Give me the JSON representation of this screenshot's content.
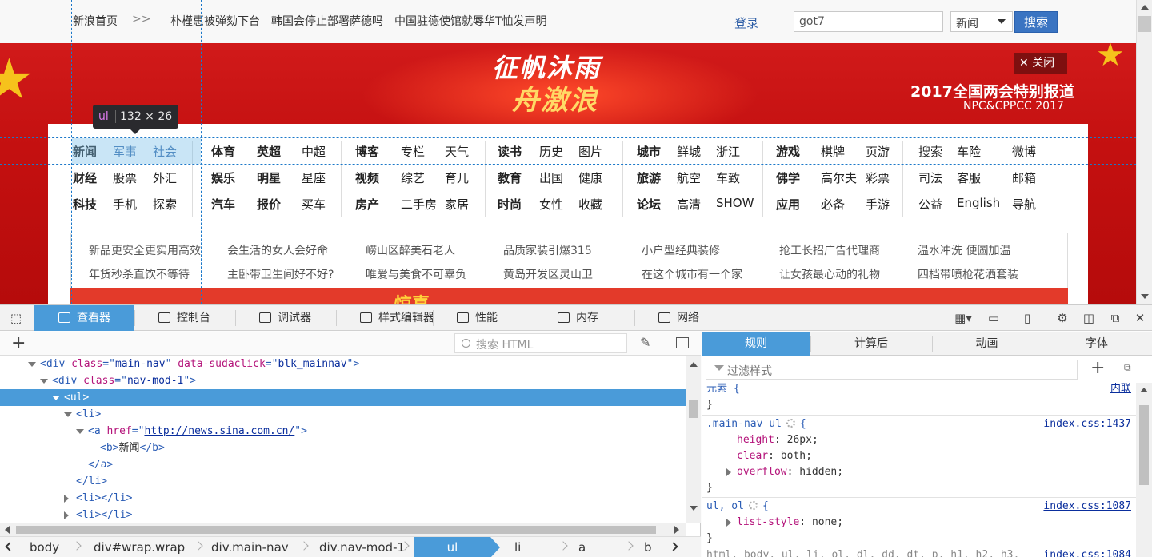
{
  "topbar": {
    "home": "新浪首页",
    "sep": ">>",
    "news": [
      "朴槿惠被弹劾下台",
      "韩国会停止部署萨德吗",
      "中国驻德使馆就辱华T恤发声明"
    ],
    "login": "登录",
    "search_value": "got7",
    "category": "新闻",
    "search_button": "搜索"
  },
  "banner": {
    "title1": "征帆沐雨",
    "title2": "舟激浪",
    "right1": "2017全国两会特别报道",
    "right2": "NPC&CPPCC 2017",
    "close": "关闭"
  },
  "nav": {
    "rows": [
      [
        "新闻",
        "军事",
        "社会",
        "体育",
        "英超",
        "中超",
        "博客",
        "专栏",
        "天气",
        "读书",
        "历史",
        "图片",
        "城市",
        "鲜城",
        "浙江",
        "游戏",
        "棋牌",
        "页游",
        "搜索",
        "车险",
        "微博"
      ],
      [
        "财经",
        "股票",
        "外汇",
        "娱乐",
        "明星",
        "星座",
        "视频",
        "综艺",
        "育儿",
        "教育",
        "出国",
        "健康",
        "旅游",
        "航空",
        "车致",
        "佛学",
        "高尔夫",
        "彩票",
        "司法",
        "客服",
        "邮箱"
      ],
      [
        "科技",
        "手机",
        "探索",
        "汽车",
        "报价",
        "买车",
        "房产",
        "二手房",
        "家居",
        "时尚",
        "女性",
        "收藏",
        "论坛",
        "高清",
        "SHOW",
        "应用",
        "必备",
        "手游",
        "公益",
        "English",
        "导航"
      ]
    ],
    "subnav": [
      [
        "新品更安全更实用高效",
        "会生活的女人会好命",
        "崂山区醉美石老人",
        "品质家装引爆315",
        "小户型经典装修",
        "抢工长招广告代理商",
        "温水冲洗 便圖加温"
      ],
      [
        "年货秒杀直饮不等待",
        "主卧带卫生间好不好?",
        "唯爱与美食不可辜负",
        "黄岛开发区灵山卫",
        "在这个城市有一个家",
        "让女孩最心动的礼物",
        "四档带喷枪花洒套装"
      ]
    ]
  },
  "tooltip": {
    "tag": "ul",
    "size": "132 × 26"
  },
  "devtools": {
    "tabs": [
      "查看器",
      "控制台",
      "调试器",
      "样式编辑器",
      "性能",
      "内存",
      "网络"
    ],
    "search_placeholder": "搜索 HTML",
    "tree": [
      {
        "indent": 1,
        "tw": "open",
        "parts": [
          [
            "tg",
            "<div "
          ],
          [
            "an",
            "class"
          ],
          [
            "tg",
            "=\""
          ],
          [
            "av",
            "main-nav"
          ],
          [
            "tg",
            "\" "
          ],
          [
            "an",
            "data-sudaclick"
          ],
          [
            "tg",
            "=\""
          ],
          [
            "av",
            "blk_mainnav"
          ],
          [
            "tg",
            "\">"
          ]
        ]
      },
      {
        "indent": 2,
        "tw": "open",
        "parts": [
          [
            "tg",
            "<div "
          ],
          [
            "an",
            "class"
          ],
          [
            "tg",
            "=\""
          ],
          [
            "av",
            "nav-mod-1"
          ],
          [
            "tg",
            "\">"
          ]
        ]
      },
      {
        "indent": 3,
        "tw": "open",
        "sel": true,
        "parts": [
          [
            "tg",
            "<ul>"
          ]
        ]
      },
      {
        "indent": 4,
        "tw": "open",
        "parts": [
          [
            "tg",
            "<li>"
          ]
        ]
      },
      {
        "indent": 5,
        "tw": "open",
        "parts": [
          [
            "tg",
            "<a "
          ],
          [
            "an",
            "href"
          ],
          [
            "tg",
            "=\""
          ],
          [
            "lnk",
            "http://news.sina.com.cn/"
          ],
          [
            "tg",
            "\">"
          ]
        ]
      },
      {
        "indent": 6,
        "tw": "",
        "parts": [
          [
            "tg",
            "<b>"
          ],
          [
            "tx",
            "新闻"
          ],
          [
            "tg",
            "</b>"
          ]
        ]
      },
      {
        "indent": 5,
        "tw": "",
        "parts": [
          [
            "tg",
            "</a>"
          ]
        ]
      },
      {
        "indent": 4,
        "tw": "",
        "parts": [
          [
            "tg",
            "</li>"
          ]
        ]
      },
      {
        "indent": 4,
        "tw": "closed",
        "parts": [
          [
            "tg",
            "<li></li>"
          ]
        ]
      },
      {
        "indent": 4,
        "tw": "closed",
        "parts": [
          [
            "tg",
            "<li></li>"
          ]
        ]
      }
    ],
    "crumbs": [
      "body",
      "div#wrap.wrap",
      "div.main-nav",
      "div.nav-mod-1",
      "ul",
      "li",
      "a",
      "b"
    ],
    "rtabs": [
      "规则",
      "计算后",
      "动画",
      "字体"
    ],
    "filter_placeholder": "过滤样式",
    "rules": {
      "element_sel": "元素",
      "inline": "内联",
      "r1_sel": ".main-nav ul",
      "r1_src": "index.css:1437",
      "r1_props": [
        [
          "height",
          "26px"
        ],
        [
          "clear",
          "both"
        ],
        [
          "overflow",
          "hidden"
        ]
      ],
      "r2_sel": "ul, ol",
      "r2_src": "index.css:1087",
      "r2_props": [
        [
          "list-style",
          "none"
        ]
      ],
      "r3_sel": "html, body, ul, li, ol, dl, dd, dt, p, h1, h2, h3,",
      "r3_src": "index.css:1084"
    }
  }
}
